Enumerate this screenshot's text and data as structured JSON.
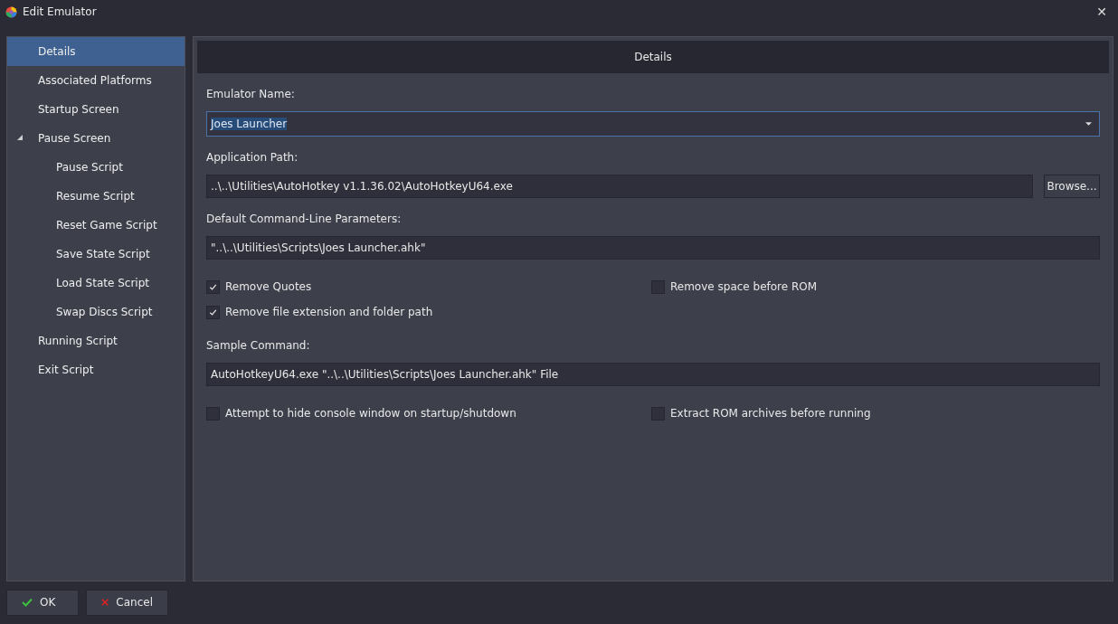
{
  "window": {
    "title": "Edit Emulator",
    "close": "✕"
  },
  "sidebar": {
    "items": [
      {
        "label": "Details",
        "selected": true
      },
      {
        "label": "Associated Platforms",
        "selected": false
      },
      {
        "label": "Startup Screen",
        "selected": false
      },
      {
        "label": "Pause Screen",
        "selected": false,
        "expanded": true,
        "children": [
          {
            "label": "Pause Script",
            "selected": false
          },
          {
            "label": "Resume Script",
            "selected": false
          },
          {
            "label": "Reset Game Script",
            "selected": false
          },
          {
            "label": "Save State Script",
            "selected": false
          },
          {
            "label": "Load State Script",
            "selected": false
          },
          {
            "label": "Swap Discs Script",
            "selected": false
          }
        ]
      },
      {
        "label": "Running Script",
        "selected": false
      },
      {
        "label": "Exit Script",
        "selected": false
      }
    ]
  },
  "panel": {
    "header": "Details",
    "emulator_name": {
      "label": "Emulator Name:",
      "value": "Joes Launcher"
    },
    "application_path": {
      "label": "Application Path:",
      "value": "..\\..\\Utilities\\AutoHotkey v1.1.36.02\\AutoHotkeyU64.exe",
      "button": "Browse..."
    },
    "parameters": {
      "label": "Default Command-Line Parameters:",
      "value": "\"..\\..\\Utilities\\Scripts\\Joes Launcher.ahk\""
    },
    "options_rows": [
      [
        {
          "label": "Remove Quotes",
          "checked": true
        },
        {
          "label": "Remove space before ROM",
          "checked": false
        }
      ],
      [
        {
          "label": "Remove file extension and folder path",
          "checked": true
        }
      ]
    ],
    "sample_command": {
      "label": "Sample Command:",
      "value": "AutoHotkeyU64.exe \"..\\..\\Utilities\\Scripts\\Joes Launcher.ahk\" File"
    },
    "extra_rows": [
      [
        {
          "label": "Attempt to hide console window on startup/shutdown",
          "checked": false
        },
        {
          "label": "Extract ROM archives before running",
          "checked": false
        }
      ]
    ]
  },
  "buttons": [
    {
      "label": "OK",
      "kind": "ok"
    },
    {
      "label": "Cancel",
      "kind": "cancel"
    }
  ]
}
